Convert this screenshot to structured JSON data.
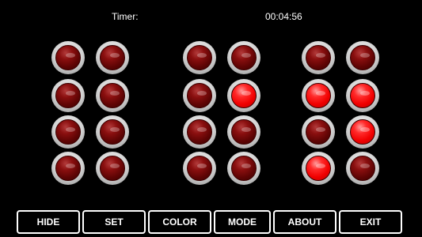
{
  "timer": {
    "label": "Timer:",
    "value": "00:04:56"
  },
  "clock": {
    "columns": [
      {
        "rows": [
          false,
          false,
          false,
          false
        ]
      },
      {
        "rows": [
          false,
          false,
          false,
          false
        ]
      },
      {
        "rows": [
          false,
          false,
          false,
          false
        ]
      },
      {
        "rows": [
          false,
          true,
          false,
          false
        ]
      },
      {
        "rows": [
          false,
          true,
          false,
          true
        ]
      },
      {
        "rows": [
          false,
          true,
          true,
          false
        ]
      }
    ],
    "colors": {
      "on": "#ff0000",
      "off": "#6e0000",
      "bezel": "#d0d0d0"
    }
  },
  "buttons": [
    {
      "id": "hide",
      "label": "HIDE"
    },
    {
      "id": "set",
      "label": "SET"
    },
    {
      "id": "color",
      "label": "COLOR"
    },
    {
      "id": "mode",
      "label": "MODE"
    },
    {
      "id": "about",
      "label": "ABOUT"
    },
    {
      "id": "exit",
      "label": "EXIT"
    }
  ]
}
